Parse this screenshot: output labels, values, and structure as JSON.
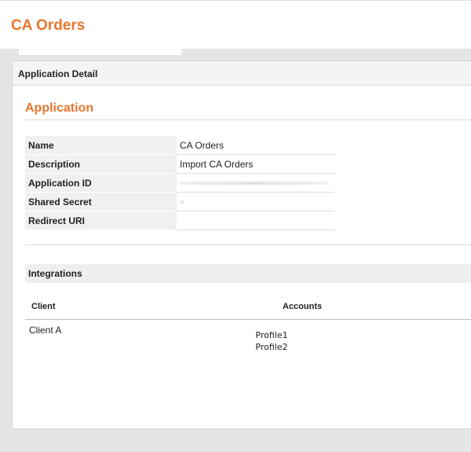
{
  "header": {
    "title": "CA Orders"
  },
  "card": {
    "title": "Application Detail"
  },
  "application": {
    "section_title": "Application",
    "fields": [
      {
        "label": "Name",
        "value": "CA Orders"
      },
      {
        "label": "Description",
        "value": "Import CA Orders"
      },
      {
        "label": "Application ID",
        "value": ""
      },
      {
        "label": "Shared Secret",
        "value": ""
      },
      {
        "label": "Redirect URI",
        "value": ""
      }
    ]
  },
  "integrations": {
    "title": "Integrations",
    "columns": [
      "Client",
      "Accounts"
    ],
    "rows": [
      {
        "client": "Client A",
        "accounts": [
          "Profile1",
          "Profile2"
        ]
      }
    ]
  },
  "colors": {
    "accent": "#e8772e",
    "background": "#e5e5e5",
    "label_bg": "#f0f0f0"
  }
}
